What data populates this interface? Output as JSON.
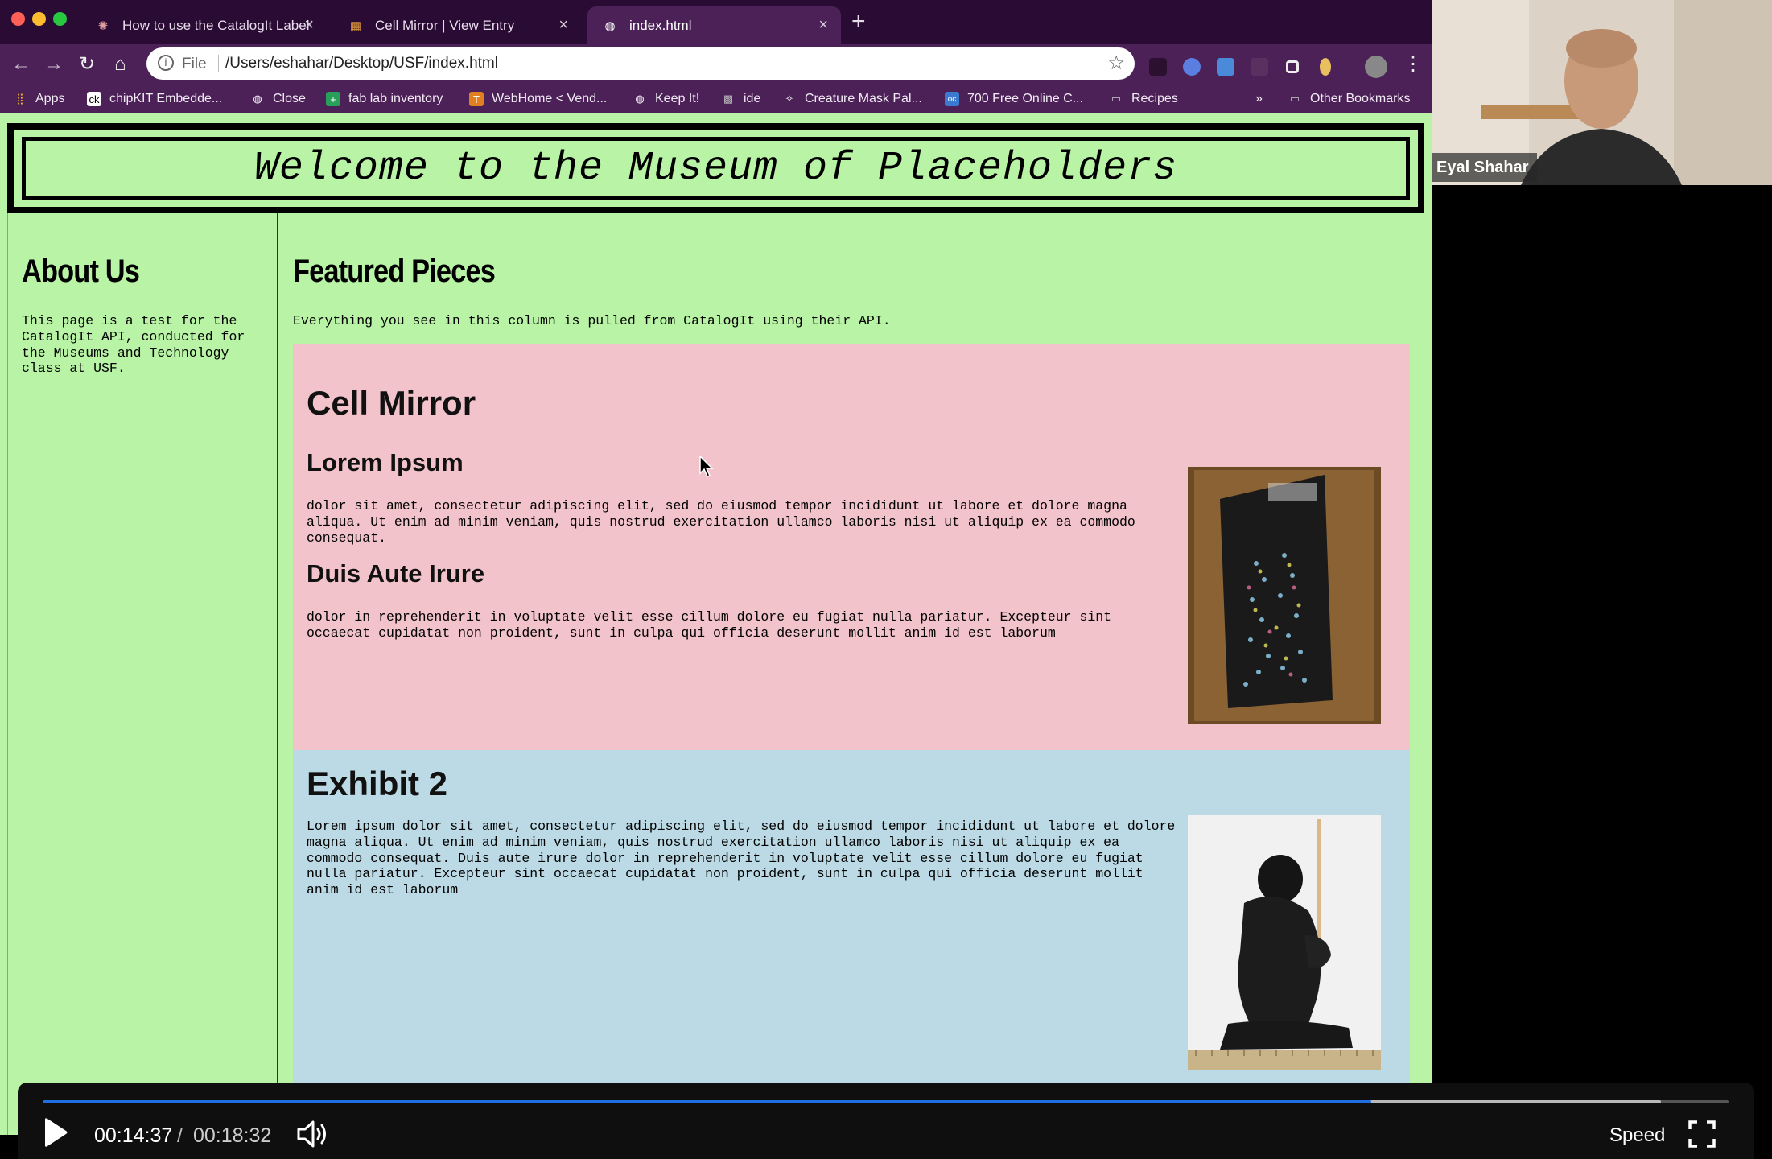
{
  "browser": {
    "tabs": [
      {
        "title": "How to use the CatalogIt Label"
      },
      {
        "title": "Cell Mirror | View Entry"
      },
      {
        "title": "index.html"
      }
    ],
    "address": {
      "scheme": "File",
      "url": "/Users/eshahar/Desktop/USF/index.html"
    },
    "bookmarks": [
      {
        "label": "Apps"
      },
      {
        "label": "chipKIT Embedde..."
      },
      {
        "label": "Close"
      },
      {
        "label": "fab lab inventory"
      },
      {
        "label": "WebHome < Vend..."
      },
      {
        "label": "Keep It!"
      },
      {
        "label": "ide"
      },
      {
        "label": "Creature Mask Pal..."
      },
      {
        "label": "700 Free Online C..."
      },
      {
        "label": "Recipes"
      }
    ],
    "overflow_label": "»",
    "other_bookmarks": "Other Bookmarks"
  },
  "site": {
    "title": "Welcome to the Museum of Placeholders",
    "about": {
      "heading": "About Us",
      "text": "This page is a test for the CatalogIt API, conducted for the Museums and Technology class at USF."
    },
    "featured": {
      "heading": "Featured Pieces",
      "intro": "Everything you see in this column is pulled from CatalogIt using their API.",
      "pieces": [
        {
          "title": "Cell Mirror",
          "sections": [
            {
              "heading": "Lorem Ipsum",
              "text": "dolor sit amet, consectetur adipiscing elit, sed do eiusmod tempor incididunt ut labore et dolore magna aliqua. Ut enim ad minim veniam, quis nostrud exercitation ullamco laboris nisi ut aliquip ex ea commodo consequat."
            },
            {
              "heading": "Duis Aute Irure",
              "text": "dolor in reprehenderit in voluptate velit esse cillum dolore eu fugiat nulla pariatur. Excepteur sint occaecat cupidatat non proident, sunt in culpa qui officia deserunt mollit anim id est laborum"
            }
          ]
        },
        {
          "title": "Exhibit 2",
          "text": "Lorem ipsum dolor sit amet, consectetur adipiscing elit, sed do eiusmod tempor incididunt ut labore et dolore magna aliqua. Ut enim ad minim veniam, quis nostrud exercitation ullamco laboris nisi ut aliquip ex ea commodo consequat. Duis aute irure dolor in reprehenderit in voluptate velit esse cillum dolore eu fugiat nulla pariatur. Excepteur sint occaecat cupidatat non proident, sunt in culpa qui officia deserunt mollit anim id est laborum"
        }
      ]
    }
  },
  "webcam": {
    "name": "Eyal Shahar"
  },
  "player": {
    "current_time": "00:14:37",
    "separator": "/",
    "total_time": "00:18:32",
    "progress_fraction": 0.788,
    "buffered_fraction": 0.96,
    "speed_label": "Speed"
  },
  "colors": {
    "page_bg": "#b9f4a6",
    "piece1_bg": "#f2c3cb",
    "piece2_bg": "#bcdae5",
    "browser_chrome": "#4b2157",
    "progress": "#1e70e0"
  }
}
